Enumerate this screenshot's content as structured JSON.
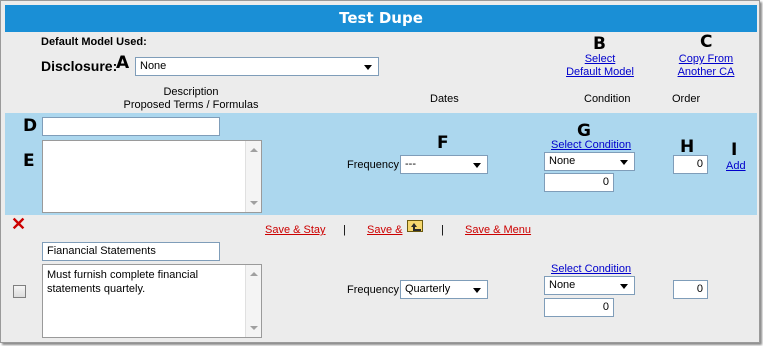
{
  "window": {
    "title": "Test Dupe"
  },
  "header": {
    "default_model_label": "Default Model Used:",
    "disclosure_label": "Disclosure:",
    "disclosure_value": "None",
    "select_default_model_line1": "Select",
    "select_default_model_line2": "Default Model",
    "copy_from_line1": "Copy From",
    "copy_from_line2": "Another CA"
  },
  "annotations": {
    "A": "A",
    "B": "B",
    "C": "C",
    "D": "D",
    "E": "E",
    "F": "F",
    "G": "G",
    "H": "H",
    "I": "I"
  },
  "columns": {
    "description_line1": "Description",
    "description_line2": "Proposed Terms / Formulas",
    "dates": "Dates",
    "condition": "Condition",
    "order": "Order"
  },
  "new_item": {
    "description_value": "",
    "terms_value": "",
    "frequency_label": "Frequency",
    "frequency_value": "---",
    "select_condition": "Select Condition",
    "condition_value": "None",
    "condition_amount": "0",
    "order_value": "0",
    "add_link": "Add"
  },
  "actions": {
    "save_stay": "Save & Stay",
    "save_folder": "Save &",
    "save_menu": "Save & Menu",
    "separator": "|"
  },
  "existing_item": {
    "description_value": "Fianancial Statements",
    "terms_value": "Must furnish complete financial statements quartely.",
    "frequency_label": "Frequency",
    "frequency_value": "Quarterly",
    "select_condition": "Select Condition",
    "condition_value": "None",
    "condition_amount": "0",
    "order_value": "0"
  },
  "icons": {
    "delete": "red-x-icon",
    "folder": "folder-up-icon"
  },
  "colors": {
    "title_bar": "#1a8fd6",
    "blue_band": "#acd7ee",
    "background": "#ececec",
    "link": "#0000cc",
    "red_link": "#cc0000"
  }
}
